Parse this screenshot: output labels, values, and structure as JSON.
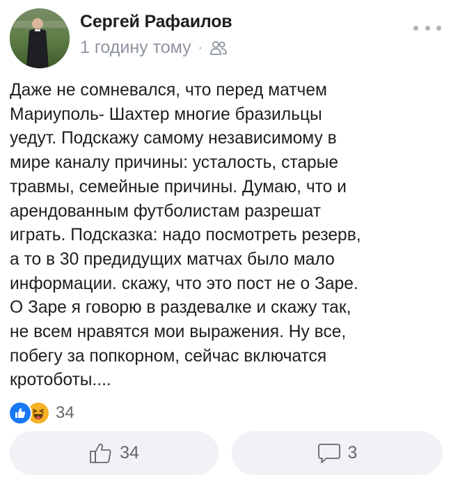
{
  "post": {
    "author": "Сергей Рафаилов",
    "timestamp": "1 годину тому",
    "separator": "·",
    "audience_icon": "friends-icon",
    "body": "Даже не сомневался, что перед матчем\nМариуполь- Шахтер многие бразильцы\nуедут. Подскажу самому независимому в\nмире каналу причины: усталость, старые\nтравмы, семейные причины. Думаю, что и\nарендованным футболистам разрешат\nиграть. Подсказка: надо посмотреть резерв,\nа то в 30 предидущих матчах было мало\nинформации. скажу, что это пост не о Заре.\nО Заре я говорю в раздевалке и скажу так,\nне всем нравятся мои выражения. Ну все,\nпобегу за попкорном, сейчас включатся\nкротоботы...."
  },
  "reactions": {
    "types": [
      "like",
      "haha"
    ],
    "count": "34"
  },
  "actions": {
    "like_count": "34",
    "comment_count": "3"
  },
  "colors": {
    "like_blue": "#1877f2",
    "haha_yellow": "#f7b125",
    "pill_bg": "#f0f2f5",
    "secondary_text": "#65676b"
  }
}
